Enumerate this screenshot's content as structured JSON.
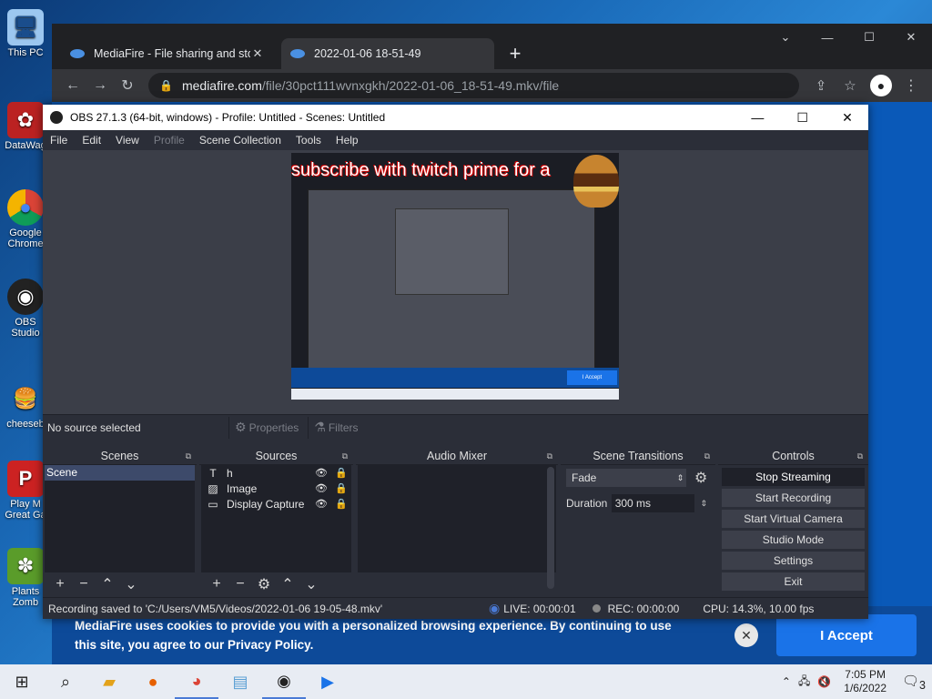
{
  "desktop": {
    "icons": [
      "This PC",
      "DataWag",
      "Google Chrome",
      "OBS Studio",
      "cheeseb",
      "Play M Great Ga",
      "Plants Zomb"
    ]
  },
  "browser": {
    "tabs": [
      {
        "title": "MediaFire - File sharing and stor",
        "close": "✕"
      },
      {
        "title": "2022-01-06 18-51-49",
        "close": ""
      }
    ],
    "new_tab": "+",
    "window_controls": [
      "⌄",
      "—",
      "☐",
      "✕"
    ],
    "nav": {
      "back": "←",
      "forward": "→",
      "reload": "↻"
    },
    "url_host": "mediafire.com",
    "url_path": "/file/30pct111wvnxgkh/2022-01-06_18-51-49.mkv/file",
    "cookie_text": "MediaFire uses cookies to provide you with a personalized browsing experience. By continuing to use this site, you agree to our Privacy Policy.",
    "cookie_close": "✕",
    "accept_label": "I Accept"
  },
  "obs": {
    "title": "OBS 27.1.3 (64-bit, windows) - Profile: Untitled - Scenes: Untitled",
    "window_controls": [
      "—",
      "☐",
      "✕"
    ],
    "menu": [
      "File",
      "Edit",
      "View",
      "Profile",
      "Scene Collection",
      "Tools",
      "Help"
    ],
    "preview_title": "subscribe with twitch prime for a",
    "preview_accept": "I Accept",
    "no_source": "No source selected",
    "properties_label": "Properties",
    "filters_label": "Filters",
    "docks": {
      "scenes": {
        "title": "Scenes",
        "items": [
          "Scene"
        ]
      },
      "sources": {
        "title": "Sources",
        "items": [
          "h",
          "Image",
          "Display Capture"
        ]
      },
      "audio": {
        "title": "Audio Mixer"
      },
      "transitions": {
        "title": "Scene Transitions",
        "type": "Fade",
        "duration_label": "Duration",
        "duration_value": "300 ms"
      },
      "controls": {
        "title": "Controls",
        "buttons": [
          "Stop Streaming",
          "Start Recording",
          "Start Virtual Camera",
          "Studio Mode",
          "Settings",
          "Exit"
        ]
      }
    },
    "status": {
      "recording_saved": "Recording saved to 'C:/Users/VM5/Videos/2022-01-06 19-05-48.mkv'",
      "live": "LIVE: 00:00:01",
      "rec": "REC: 00:00:00",
      "cpu": "CPU: 14.3%, 10.00 fps"
    }
  },
  "taskbar": {
    "time": "7:05 PM",
    "date": "1/6/2022",
    "notifications": "3"
  },
  "colors": {
    "accent": "#1a73e8",
    "obs_bg": "#2b2e38",
    "cookie_bg": "#0d4a99"
  }
}
